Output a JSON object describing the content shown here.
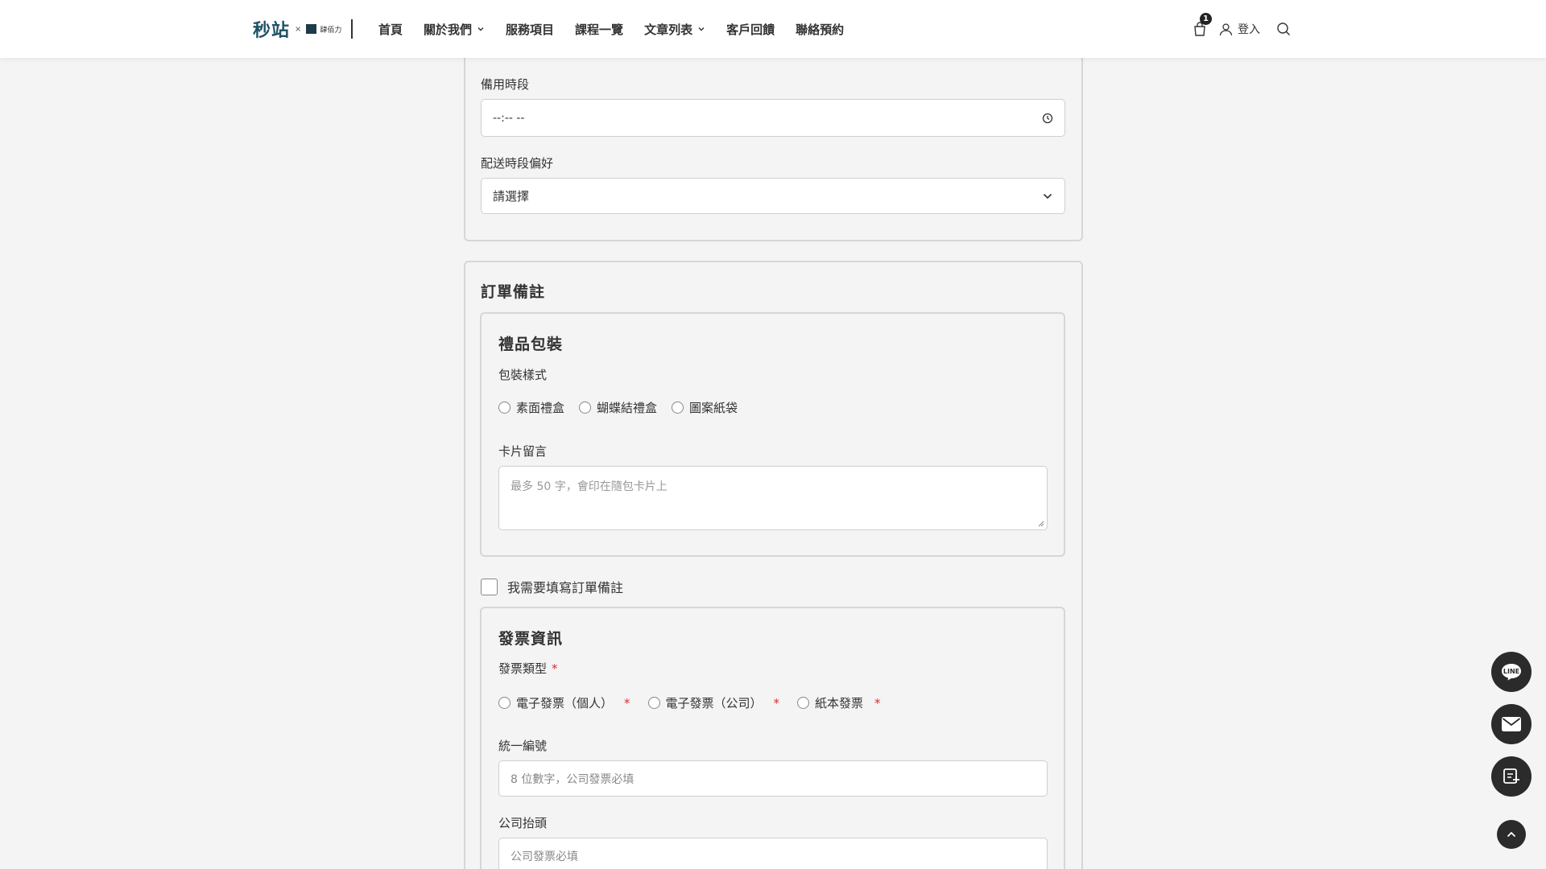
{
  "brand": {
    "logo_main": "秒站",
    "logo_x": "×",
    "logo_sub": "肆佰力",
    "primary_color": "#1f5266"
  },
  "nav": {
    "items": [
      {
        "label": "首頁",
        "has_dropdown": false
      },
      {
        "label": "關於我們",
        "has_dropdown": true
      },
      {
        "label": "服務項目",
        "has_dropdown": false
      },
      {
        "label": "課程一覽",
        "has_dropdown": false
      },
      {
        "label": "文章列表",
        "has_dropdown": true
      },
      {
        "label": "客戶回饋",
        "has_dropdown": false
      },
      {
        "label": "聯絡預約",
        "has_dropdown": false
      }
    ]
  },
  "header_right": {
    "cart_count": "1",
    "login_label": "登入",
    "icons": [
      "shopping-bag-icon",
      "user-icon",
      "search-icon"
    ]
  },
  "delivery": {
    "backup_time_label": "備用時段",
    "backup_time_value": "--:-- --",
    "preference_label": "配送時段偏好",
    "preference_value": "請選擇"
  },
  "order_notes": {
    "title": "訂單備註",
    "gift": {
      "title": "禮品包裝",
      "style_label": "包裝樣式",
      "style_options": [
        "素面禮盒",
        "蝴蝶結禮盒",
        "圖案紙袋"
      ],
      "card_label": "卡片留言",
      "card_placeholder": "最多 50 字，會印在隨包卡片上"
    },
    "need_notes_label": "我需要填寫訂單備註",
    "invoice": {
      "title": "發票資訊",
      "type_label": "發票類型",
      "required_mark": "*",
      "type_options": [
        "電子發票（個人）",
        "電子發票（公司）",
        "紙本發票"
      ],
      "tax_id_label": "統一編號",
      "tax_id_placeholder": "8 位數字，公司發票必填",
      "company_label": "公司抬頭",
      "company_placeholder": "公司發票必填"
    }
  },
  "floating": {
    "line_label": "LINE",
    "icons": [
      "line-chat-icon",
      "mail-icon",
      "booking-icon",
      "chevron-up-icon"
    ]
  }
}
